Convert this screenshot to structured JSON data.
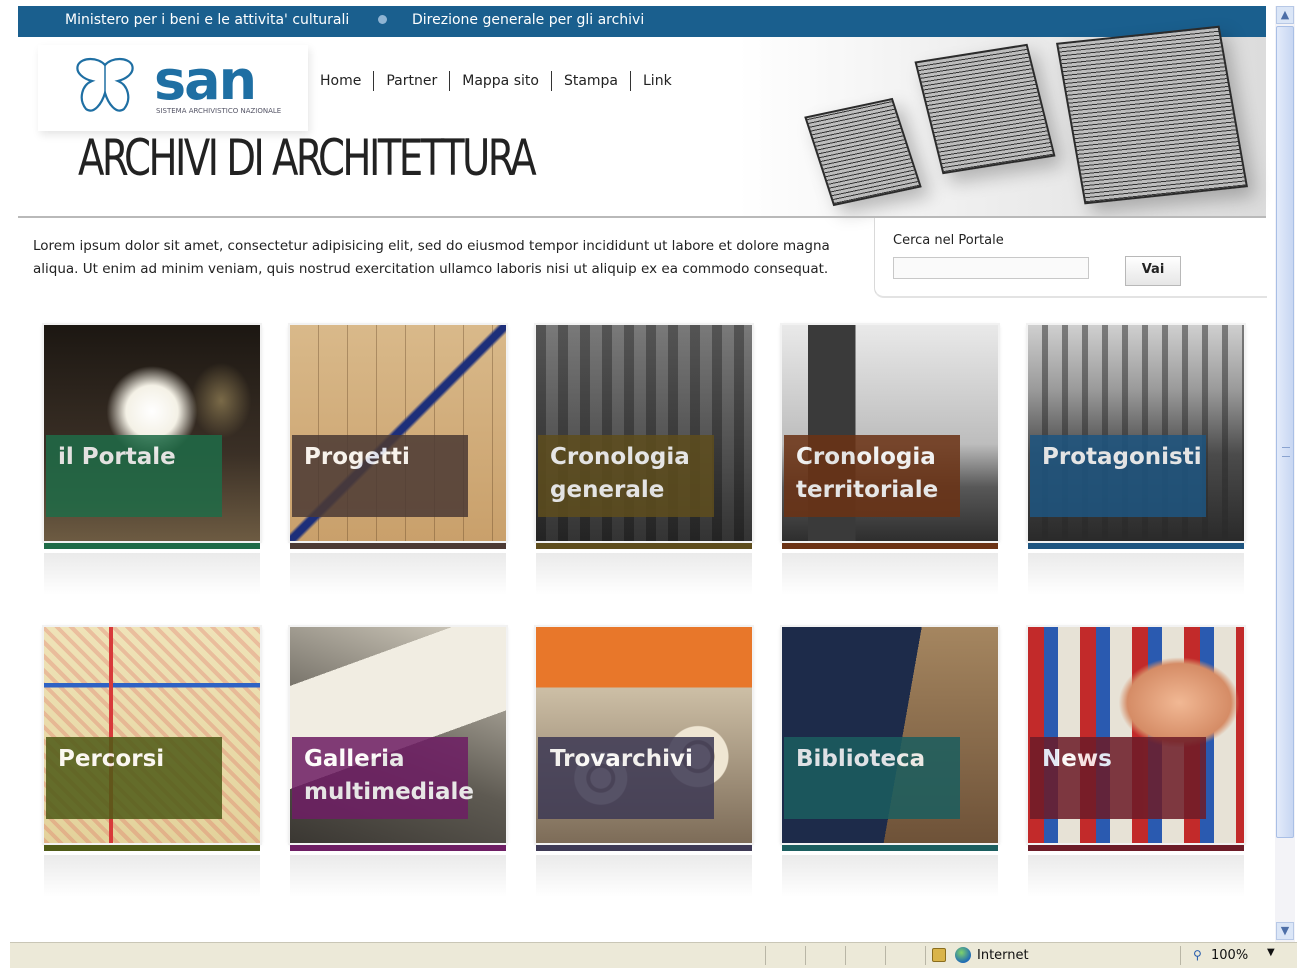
{
  "topbar": {
    "left": "Ministero per i beni e le attivita' culturali",
    "right": "Direzione generale per gli archivi"
  },
  "logo": {
    "text": "san",
    "subtitle": "SISTEMA ARCHIVISTICO NAZIONALE"
  },
  "nav": [
    "Home",
    "Partner",
    "Mappa sito",
    "Stampa",
    "Link"
  ],
  "site_title": "ARCHIVI DI ARCHITETTURA",
  "intro": "Lorem ipsum dolor sit amet, consectetur adipisicing elit, sed do eiusmod tempor incididunt ut labore et dolore magna aliqua. Ut enim ad minim veniam, quis nostrud exercitation ullamco laboris nisi ut aliquip ex ea commodo consequat.",
  "search": {
    "label": "Cerca nel Portale",
    "value": "",
    "button": "Vai"
  },
  "tiles": [
    {
      "label": "il Portale",
      "color": "#1f6b47"
    },
    {
      "label": "Progetti",
      "color": "#4c3a34"
    },
    {
      "label": "Cronologia generale",
      "color": "#5e4d1d"
    },
    {
      "label": "Cronologia territoriale",
      "color": "#6b3214"
    },
    {
      "label": "Protagonisti",
      "color": "#1e5580"
    },
    {
      "label": "Percorsi",
      "color": "#4f5b17"
    },
    {
      "label": "Galleria multimediale",
      "color": "#6e1e64"
    },
    {
      "label": "Trovarchivi",
      "color": "#3e3a55"
    },
    {
      "label": "Biblioteca",
      "color": "#1b5e5f"
    },
    {
      "label": "News",
      "color": "#6c1c28"
    }
  ],
  "status": {
    "zone": "Internet",
    "zoom": "100%"
  }
}
